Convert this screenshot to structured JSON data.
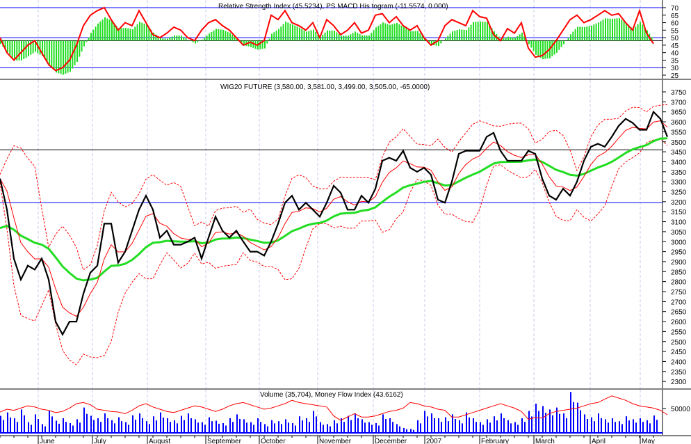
{
  "chart_data": [
    {
      "type": "line",
      "title": "Relative Strength Index (45.5234), PS MACD His togram (-11.5574, 0.000)",
      "ylim": [
        22,
        73
      ],
      "yticks": [
        25,
        30,
        35,
        40,
        45,
        50,
        55,
        60,
        65,
        70
      ],
      "reference_lines": [
        70,
        50,
        30
      ],
      "histogram_baseline": 48,
      "series": [
        {
          "name": "Relative Strength Index",
          "color": "#ff0000",
          "values": [
            50,
            40,
            35,
            40,
            45,
            48,
            40,
            32,
            28,
            30,
            35,
            45,
            58,
            65,
            68,
            70,
            62,
            55,
            60,
            58,
            68,
            60,
            52,
            50,
            53,
            57,
            55,
            50,
            48,
            55,
            60,
            62,
            58,
            55,
            50,
            45,
            47,
            45,
            48,
            65,
            62,
            68,
            60,
            58,
            55,
            60,
            50,
            62,
            58,
            52,
            55,
            60,
            53,
            55,
            65,
            66,
            60,
            64,
            58,
            55,
            58,
            50,
            45,
            48,
            58,
            62,
            60,
            58,
            68,
            64,
            63,
            52,
            48,
            56,
            53,
            60,
            43,
            37,
            38,
            42,
            48,
            55,
            62,
            65,
            60,
            62,
            65,
            68,
            65,
            66,
            60,
            55,
            68,
            53,
            46
          ]
        },
        {
          "name": "PS MACD Histogram",
          "color": "#00dd00",
          "type": "histogram"
        }
      ]
    },
    {
      "type": "line",
      "title": "WIG20 FUTURE (3,580.00, 3,581.00, 3,499.00, 3,505.00, -65.0000)",
      "ylim": [
        2270,
        3790
      ],
      "yticks": [
        2300,
        2350,
        2400,
        2450,
        2500,
        2550,
        2600,
        2650,
        2700,
        2750,
        2800,
        2850,
        2900,
        2950,
        3000,
        3050,
        3100,
        3150,
        3200,
        3250,
        3300,
        3350,
        3400,
        3450,
        3500,
        3550,
        3600,
        3650,
        3700,
        3750
      ],
      "reference_lines": [
        {
          "value": 3460,
          "color": "#000000"
        },
        {
          "value": 3195,
          "color": "#0000ff"
        }
      ],
      "series": [
        {
          "name": "WIG20 FUTURE",
          "color": "#000000",
          "values": [
            3316,
            3160,
            2915,
            2810,
            2880,
            2860,
            2915,
            2810,
            2600,
            2535,
            2600,
            2600,
            2740,
            2845,
            2880,
            3090,
            3090,
            2895,
            2950,
            3055,
            3160,
            3230,
            3160,
            3020,
            3055,
            2985,
            2985,
            3000,
            3020,
            2915,
            3020,
            3125,
            3055,
            3020,
            3055,
            3000,
            2950,
            2950,
            2930,
            3000,
            3090,
            3195,
            3230,
            3160,
            3195,
            3160,
            3125,
            3195,
            3280,
            3245,
            3160,
            3160,
            3230,
            3195,
            3265,
            3405,
            3420,
            3405,
            3455,
            3370,
            3350,
            3370,
            3335,
            3210,
            3195,
            3300,
            3440,
            3455,
            3455,
            3455,
            3525,
            3545,
            3455,
            3405,
            3405,
            3405,
            3455,
            3440,
            3315,
            3230,
            3210,
            3265,
            3230,
            3300,
            3405,
            3475,
            3490,
            3475,
            3525,
            3580,
            3615,
            3595,
            3560,
            3560,
            3650,
            3615,
            3525
          ]
        },
        {
          "name": "Moving Average (short)",
          "color": "#ff0000",
          "period": 4
        },
        {
          "name": "Moving Average (long)",
          "color": "#22dd22",
          "period": 16,
          "seed": 3035
        },
        {
          "name": "Bollinger Bands",
          "color": "#ff0000",
          "style": "dashed",
          "period": 6,
          "k": 2
        }
      ]
    },
    {
      "type": "bar",
      "title": "Volume (35,704), Money Flow Index (43.6162)",
      "ylim": [
        0,
        88000
      ],
      "yticks": [
        50000
      ],
      "series": [
        {
          "name": "Volume",
          "color": "#0000ff",
          "values": [
            35000,
            42000,
            30000,
            48000,
            22000,
            38000,
            18000,
            45000,
            25000,
            30000,
            20000,
            28000,
            52000,
            35000,
            30000,
            40000,
            26000,
            32000,
            22000,
            36000,
            40000,
            24000,
            34000,
            42000,
            30000,
            26000,
            35000,
            40000,
            28000,
            22000,
            32000,
            25000,
            20000,
            30000,
            38000,
            28000,
            22000,
            30000,
            18000,
            26000,
            24000,
            28000,
            20000,
            34000,
            30000,
            45000,
            22000,
            18000,
            26000,
            30000,
            35000,
            40000,
            28000,
            22000,
            20000,
            38000,
            30000,
            18000,
            10000,
            8000,
            26000,
            45000,
            40000,
            30000,
            32000,
            38000,
            26000,
            42000,
            30000,
            22000,
            28000,
            34000,
            40000,
            26000,
            22000,
            30000,
            45000,
            60000,
            55000,
            48000,
            52000,
            40000,
            84000,
            62000,
            38000,
            32000,
            40000,
            28000,
            30000,
            24000,
            34000,
            28000,
            30000,
            26000,
            35704
          ]
        },
        {
          "name": "Money Flow Index",
          "color": "#ff0000",
          "type": "line",
          "ylim": [
            0,
            100
          ],
          "values": [
            55,
            60,
            58,
            62,
            66,
            64,
            60,
            58,
            54,
            56,
            62,
            70,
            72,
            68,
            60,
            58,
            56,
            55,
            52,
            58,
            66,
            70,
            64,
            60,
            56,
            54,
            58,
            62,
            66,
            64,
            60,
            56,
            60,
            66,
            70,
            72,
            68,
            64,
            60,
            62,
            66,
            70,
            76,
            72,
            70,
            68,
            66,
            64,
            48,
            40,
            46,
            52,
            46,
            46,
            48,
            52,
            56,
            58,
            62,
            72,
            70,
            66,
            64,
            60,
            58,
            46,
            46,
            50,
            54,
            58,
            62,
            66,
            70,
            66,
            62,
            56,
            42,
            45,
            44,
            52,
            56,
            58,
            60,
            62,
            66,
            70,
            72,
            78,
            84,
            80,
            76,
            70,
            66,
            64,
            62,
            58,
            50
          ]
        }
      ]
    }
  ],
  "x_axis": {
    "labels": [
      "June",
      "July",
      "August",
      "September",
      "October",
      "November",
      "December",
      "2007",
      "February",
      "March",
      "April",
      "May"
    ]
  }
}
